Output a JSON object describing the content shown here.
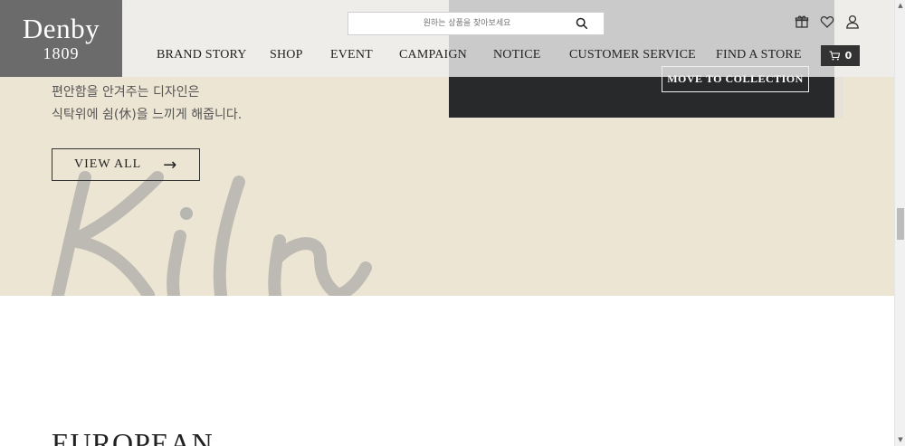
{
  "brand": {
    "name": "Denby",
    "year": "1809"
  },
  "search": {
    "placeholder": "원하는 상품을 찾아보세요"
  },
  "nav": {
    "items": [
      "BRAND STORY",
      "SHOP",
      "EVENT",
      "CAMPAIGN",
      "NOTICE",
      "CUSTOMER SERVICE",
      "FIND A STORE"
    ]
  },
  "cart": {
    "count": "0"
  },
  "hero": {
    "line1": "편안함을 안겨주는 디자인은",
    "line2": "식탁위에 쉼(休)을 느끼게 해줍니다.",
    "view_all": "VIEW ALL",
    "move_to_collection": "MOVE TO COLLECTION",
    "script_word": "Kiln"
  },
  "section": {
    "heading": "EUROPEAN"
  },
  "icons": {
    "gift": "gift-icon",
    "heart": "heart-icon",
    "user": "user-icon",
    "search": "search-icon",
    "cart": "cart-icon"
  },
  "colors": {
    "hero_bg": "#ece5d3",
    "dark_panel": "#27292b",
    "logo_bg": "#6b6b6b",
    "cart_bg": "#333333"
  }
}
